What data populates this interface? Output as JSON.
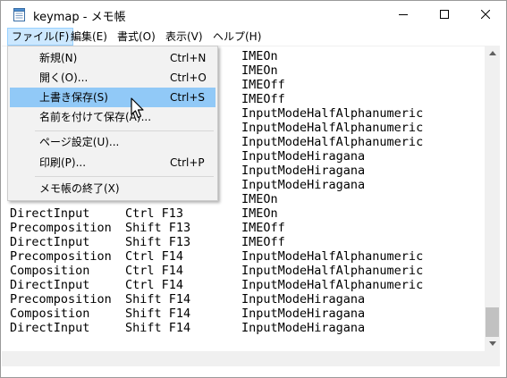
{
  "window": {
    "title": "keymap - メモ帳"
  },
  "icons": {
    "app": "notepad-icon",
    "minimize": "minimize-icon",
    "maximize": "maximize-icon",
    "close": "close-icon",
    "cursor": "mouse-cursor-icon"
  },
  "menubar": {
    "items": [
      {
        "label": "ファイル(F)"
      },
      {
        "label": "編集(E)"
      },
      {
        "label": "書式(O)"
      },
      {
        "label": "表示(V)"
      },
      {
        "label": "ヘルプ(H)"
      }
    ]
  },
  "file_menu": {
    "items": [
      {
        "label": "新規(N)",
        "shortcut": "Ctrl+N"
      },
      {
        "label": "開く(O)...",
        "shortcut": "Ctrl+O"
      },
      {
        "label": "上書き保存(S)",
        "shortcut": "Ctrl+S"
      },
      {
        "label": "名前を付けて保存(A)...",
        "shortcut": ""
      },
      {
        "label": "ページ設定(U)...",
        "shortcut": ""
      },
      {
        "label": "印刷(P)...",
        "shortcut": "Ctrl+P"
      },
      {
        "label": "メモ帳の終了(X)",
        "shortcut": ""
      }
    ],
    "highlighted_index": 2
  },
  "editor": {
    "lines": [
      [
        "",
        "",
        "IMEOn"
      ],
      [
        "",
        "",
        "IMEOn"
      ],
      [
        "",
        "",
        "IMEOff"
      ],
      [
        "",
        "",
        "IMEOff"
      ],
      [
        "",
        "",
        "InputModeHalfAlphanumeric"
      ],
      [
        "",
        "",
        "InputModeHalfAlphanumeric"
      ],
      [
        "",
        "",
        "InputModeHalfAlphanumeric"
      ],
      [
        "",
        "",
        "InputModeHiragana"
      ],
      [
        "",
        "",
        "InputModeHiragana"
      ],
      [
        "",
        "",
        "InputModeHiragana"
      ],
      [
        "",
        "",
        "IMEOn"
      ],
      [
        "DirectInput",
        "Ctrl F13",
        "IMEOn"
      ],
      [
        "Precomposition",
        "Shift F13",
        "IMEOff"
      ],
      [
        "DirectInput",
        "Shift F13",
        "IMEOff"
      ],
      [
        "Precomposition",
        "Ctrl F14",
        "InputModeHalfAlphanumeric"
      ],
      [
        "Composition",
        "Ctrl F14",
        "InputModeHalfAlphanumeric"
      ],
      [
        "DirectInput",
        "Ctrl F14",
        "InputModeHalfAlphanumeric"
      ],
      [
        "Precomposition",
        "Shift F14",
        "InputModeHiragana"
      ],
      [
        "Composition",
        "Shift F14",
        "InputModeHiragana"
      ],
      [
        "DirectInput",
        "Shift F14",
        "InputModeHiragana"
      ]
    ]
  }
}
